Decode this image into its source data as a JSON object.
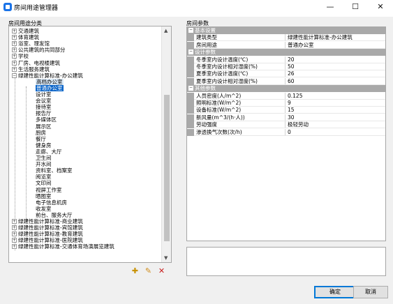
{
  "window": {
    "title": "房间用途管理器",
    "minimize": "—",
    "maximize": "☐",
    "close": "✕"
  },
  "tree_panel": {
    "label": "房间用途分类",
    "items": [
      {
        "label": "交通建筑",
        "level": 1,
        "expander": "+"
      },
      {
        "label": "体育建筑",
        "level": 1,
        "expander": "+"
      },
      {
        "label": "浴室、理发馆",
        "level": 1,
        "expander": "+"
      },
      {
        "label": "公共建筑的共同部分",
        "level": 1,
        "expander": "+"
      },
      {
        "label": "学校",
        "level": 1,
        "expander": "+"
      },
      {
        "label": "厂房、电视楼建筑",
        "level": 1,
        "expander": "+"
      },
      {
        "label": "生活服务建筑",
        "level": 1,
        "expander": "+"
      },
      {
        "label": "绿建性能计算标准-办公建筑",
        "level": 1,
        "expander": "−"
      },
      {
        "label": "高档办公室",
        "level": 2,
        "state": "hl"
      },
      {
        "label": "普通办公室",
        "level": 2,
        "state": "sel"
      },
      {
        "label": "设计室",
        "level": 2
      },
      {
        "label": "会议室",
        "level": 2
      },
      {
        "label": "接待室",
        "level": 2
      },
      {
        "label": "报告厅",
        "level": 2
      },
      {
        "label": "多媒体区",
        "level": 2
      },
      {
        "label": "展示区",
        "level": 2
      },
      {
        "label": "厨房",
        "level": 2
      },
      {
        "label": "餐厅",
        "level": 2
      },
      {
        "label": "健身房",
        "level": 2
      },
      {
        "label": "走廊、大厅",
        "level": 2
      },
      {
        "label": "卫生间",
        "level": 2
      },
      {
        "label": "开水间",
        "level": 2
      },
      {
        "label": "资料室、档案室",
        "level": 2
      },
      {
        "label": "阅览室",
        "level": 2
      },
      {
        "label": "文印间",
        "level": 2
      },
      {
        "label": "视屏工作室",
        "level": 2
      },
      {
        "label": "晒图室",
        "level": 2
      },
      {
        "label": "电子信息机房",
        "level": 2
      },
      {
        "label": "收发室",
        "level": 2
      },
      {
        "label": "前台、服务大厅",
        "level": 2
      },
      {
        "label": "绿建性能计算标准-商业建筑",
        "level": 1,
        "expander": "+"
      },
      {
        "label": "绿建性能计算标准-宾馆建筑",
        "level": 1,
        "expander": "+"
      },
      {
        "label": "绿建性能计算标准-教育建筑",
        "level": 1,
        "expander": "+"
      },
      {
        "label": "绿建性能计算标准-医院建筑",
        "level": 1,
        "expander": "+"
      },
      {
        "label": "绿建性能计算标准-交通体育场演展览建筑",
        "level": 1,
        "expander": "+"
      }
    ],
    "scroll_up": "▲",
    "scroll_down": "▼",
    "toolbar": {
      "add_icon": "add-folder-icon",
      "edit_icon": "pencil-icon",
      "delete_icon": "delete-x-icon",
      "delete_glyph": "✕",
      "edit_glyph": "✎",
      "add_glyph": "✚"
    }
  },
  "prop_panel": {
    "label": "房间参数",
    "rows": [
      {
        "type": "cat",
        "label": "基本设置",
        "toggle": "−"
      },
      {
        "type": "prop",
        "name": "建筑类型",
        "value": "绿建性能计算标准-办公建筑"
      },
      {
        "type": "prop",
        "name": "房间用途",
        "value": "普通办公室"
      },
      {
        "type": "cat",
        "label": "设计参数",
        "toggle": "−"
      },
      {
        "type": "prop",
        "name": "冬季室内设计温度(℃)",
        "value": "20"
      },
      {
        "type": "prop",
        "name": "冬季室内设计相对湿度(%)",
        "value": "50"
      },
      {
        "type": "prop",
        "name": "夏季室内设计温度(℃)",
        "value": "26"
      },
      {
        "type": "prop",
        "name": "夏季室内设计相对湿度(%)",
        "value": "60"
      },
      {
        "type": "cat",
        "label": "其他参数",
        "toggle": "−"
      },
      {
        "type": "prop",
        "name": "人员密度(人/m^2)",
        "value": "0.125"
      },
      {
        "type": "prop",
        "name": "照明标准(W/m^2)",
        "value": "9"
      },
      {
        "type": "prop",
        "name": "设备标准(W/m^2)",
        "value": "15"
      },
      {
        "type": "prop",
        "name": "新风量(m^3/(h·人))",
        "value": "30"
      },
      {
        "type": "prop",
        "name": "劳动强度",
        "value": "极轻劳动"
      },
      {
        "type": "prop",
        "name": "渗透换气次数(次/h)",
        "value": "0"
      }
    ]
  },
  "buttons": {
    "ok": "确定",
    "cancel": "取消"
  },
  "colors": {
    "selection": "#0a64c8",
    "category_bg": "#a9a9a9",
    "dialog_bg": "#f0f0f0"
  }
}
